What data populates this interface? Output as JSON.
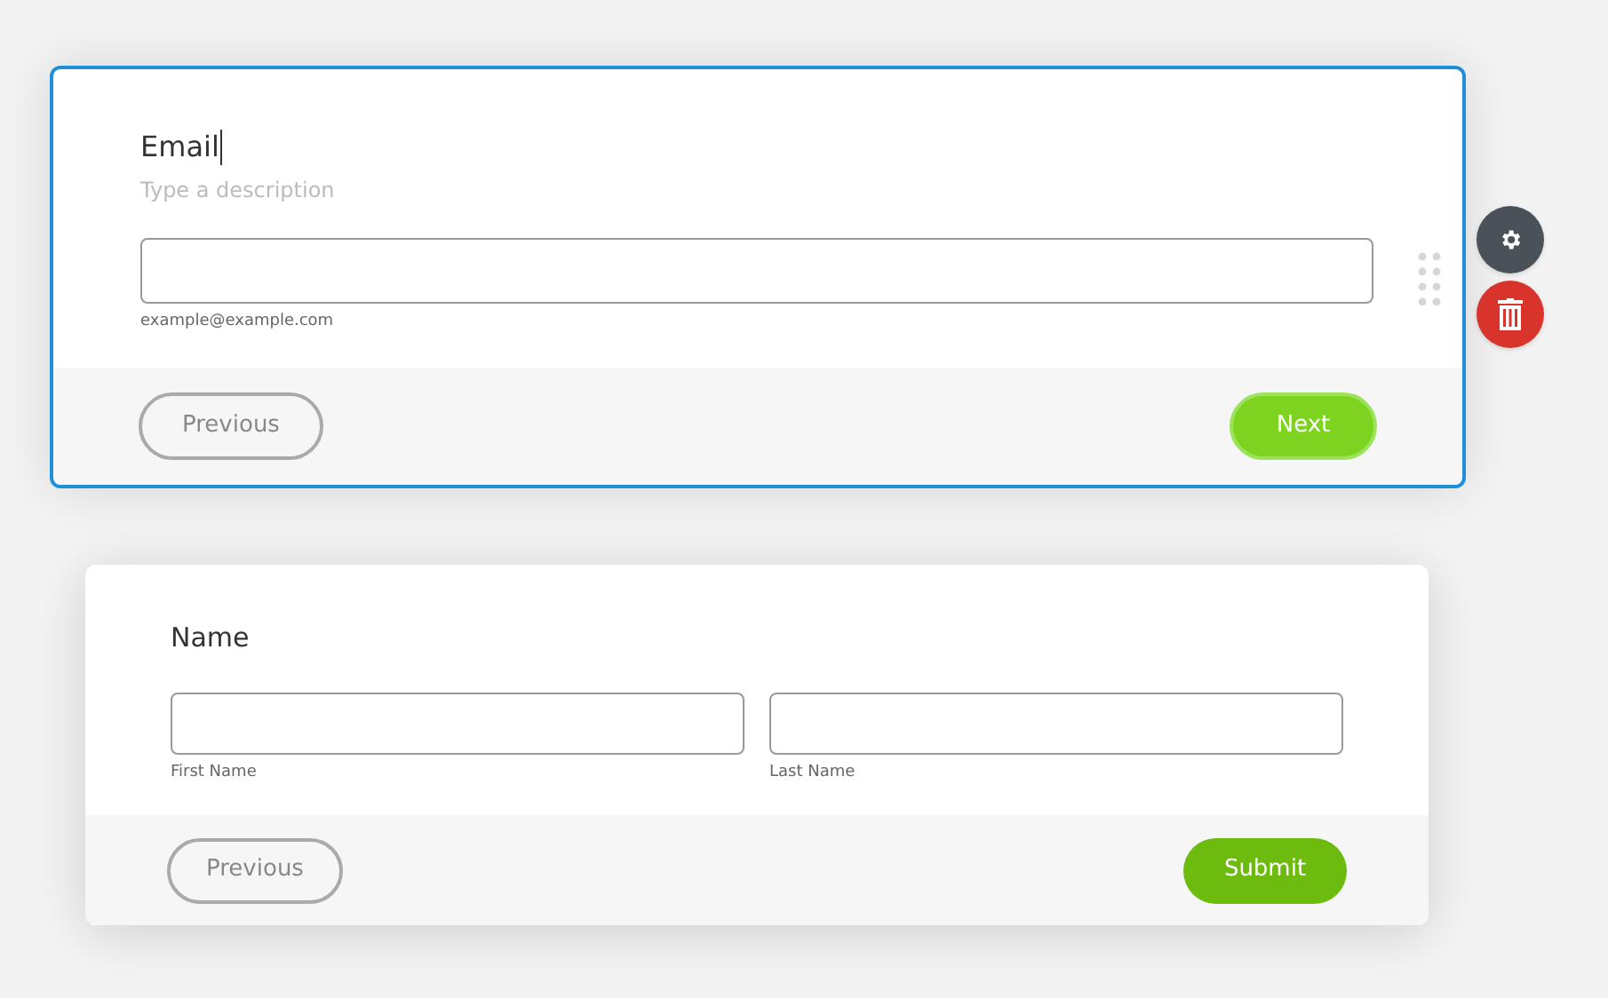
{
  "cards": [
    {
      "selected": true,
      "title": "Email",
      "description_placeholder": "Type a description",
      "fields": [
        {
          "sublabel": "example@example.com"
        }
      ],
      "buttons": [
        {
          "label": "Previous",
          "kind": "previous"
        },
        {
          "label": "Next",
          "kind": "next"
        }
      ]
    },
    {
      "selected": false,
      "title": "Name",
      "fields": [
        {
          "sublabel": "First Name"
        },
        {
          "sublabel": "Last Name"
        }
      ],
      "buttons": [
        {
          "label": "Previous",
          "kind": "previous"
        },
        {
          "label": "Submit",
          "kind": "submit"
        }
      ]
    }
  ]
}
